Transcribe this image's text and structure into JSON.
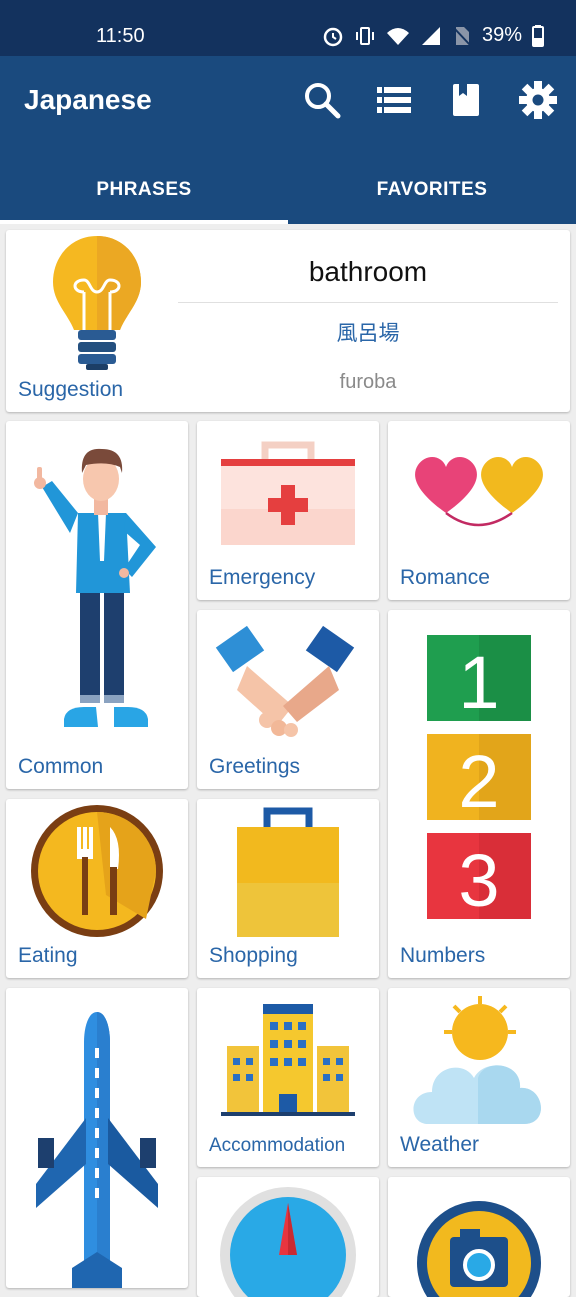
{
  "status": {
    "time": "11:50",
    "battery": "39%",
    "icons": [
      "alarm-icon",
      "vibrate-icon",
      "wifi-icon",
      "signal-icon",
      "no-sim-icon",
      "battery-icon"
    ]
  },
  "appbar": {
    "title": "Japanese",
    "actions": [
      "search-icon",
      "list-icon",
      "book-icon",
      "settings-icon"
    ]
  },
  "tabs": [
    {
      "label": "PHRASES",
      "active": true
    },
    {
      "label": "FAVORITES",
      "active": false
    }
  ],
  "suggestion": {
    "label": "Suggestion",
    "english": "bathroom",
    "japanese": "風呂場",
    "romaji": "furoba"
  },
  "categories": {
    "common": "Common",
    "emergency": "Emergency",
    "romance": "Romance",
    "greetings": "Greetings",
    "numbers": "Numbers",
    "eating": "Eating",
    "shopping": "Shopping",
    "accommodation": "Accommodation",
    "weather": "Weather"
  },
  "colors": {
    "status_bar": "#13325e",
    "app_bar": "#1a4a7e",
    "label": "#2a66a8"
  }
}
